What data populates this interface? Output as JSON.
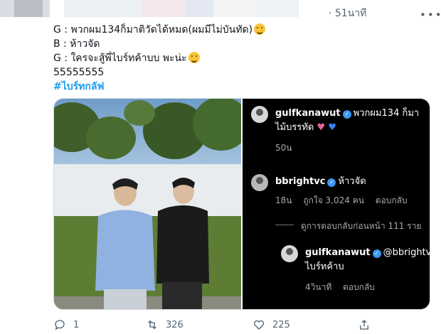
{
  "tweet": {
    "timestamp": "· 51นาที",
    "more_label": "•••",
    "lines": [
      "G : พวกผม134ก็มาติวัดได้หมด(ผมมีไม่บันทัด)",
      "B : ห้าวจัด",
      "G : ใครจะสู้พี่ไบร์ทค้าบบ พะน่ะ",
      "55555555"
    ],
    "hashtag": "#ไบร์ทกลัฟ"
  },
  "comments": {
    "c1_user": "gulfkanawut",
    "c1_text": "พวกผม134 ก็มา",
    "c1_text2": "ไม้บรรทัด",
    "c1_time": "50น",
    "c2_user": "bbrightvc",
    "c2_text": "ห้าวจัด",
    "c2_time": "18น",
    "c2_likes": "ถูกใจ 3,024 คน",
    "c2_reply": "ตอบกลับ",
    "view_replies": "ดูการตอบกลับก่อนหน้า 111 ราย",
    "c3_user": "gulfkanawut",
    "c3_text": "@bbrightv",
    "c3_text2": "ไบร์ทค้าบ",
    "c3_time": "4วินาที",
    "c3_reply": "ตอบกลับ",
    "heart_colors": [
      "#e8609a",
      "#3b82f6"
    ]
  },
  "actions": {
    "reply_count": "1",
    "retweet_count": "326",
    "like_count": "225"
  },
  "colors": {
    "accent": "#1d9bf0",
    "muted": "#536471",
    "comment_bg": "#000000"
  }
}
